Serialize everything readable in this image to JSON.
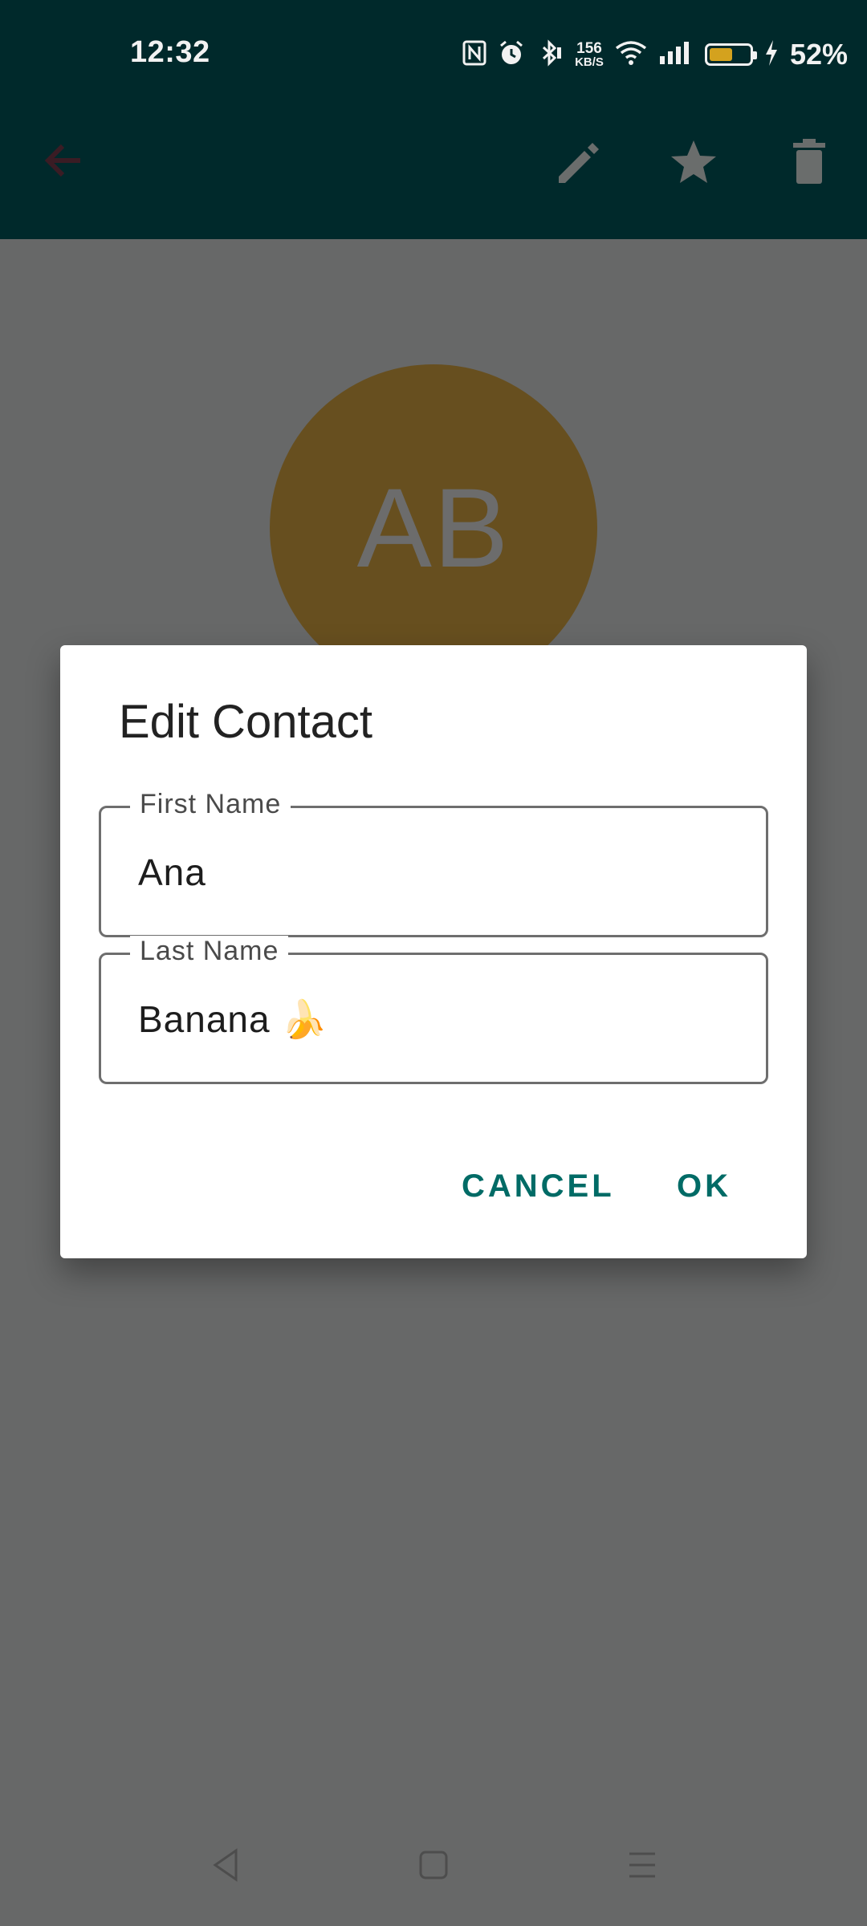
{
  "status_bar": {
    "time": "12:32",
    "speed_value": "156",
    "speed_unit": "KB/S",
    "battery_percent": "52%",
    "battery_level": 0.52
  },
  "app_bar": {
    "icons": [
      "back-arrow-icon",
      "edit-icon",
      "star-icon",
      "delete-icon"
    ]
  },
  "avatar": {
    "initials": "AB",
    "color": "#674f1f"
  },
  "dialog": {
    "title": "Edit Contact",
    "first_name_label": "First Name",
    "first_name_value": "Ana",
    "last_name_label": "Last Name",
    "last_name_value": "Banana 🍌",
    "cancel_label": "CANCEL",
    "ok_label": "OK"
  },
  "colors": {
    "app_bar": "#00292b",
    "accent": "#006b66",
    "scrim_bg": "#676868"
  }
}
